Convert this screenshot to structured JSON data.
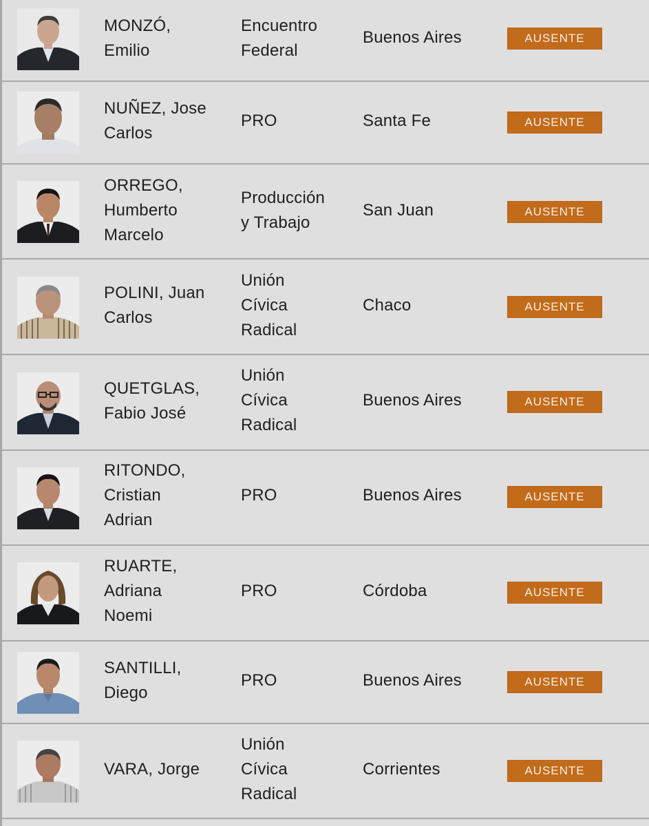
{
  "rows": [
    {
      "name_lines": [
        "MONZÓ,",
        "Emilio"
      ],
      "party_lines": [
        "Encuentro",
        "Federal"
      ],
      "district": "Buenos Aires",
      "status": "AUSENTE"
    },
    {
      "name_lines": [
        "NUÑEZ, Jose",
        "Carlos"
      ],
      "party_lines": [
        "PRO"
      ],
      "district": "Santa Fe",
      "status": "AUSENTE"
    },
    {
      "name_lines": [
        "ORREGO,",
        "Humberto",
        "Marcelo"
      ],
      "party_lines": [
        "Producción",
        "y Trabajo"
      ],
      "district": "San Juan",
      "status": "AUSENTE"
    },
    {
      "name_lines": [
        "POLINI, Juan",
        "Carlos"
      ],
      "party_lines": [
        "Unión",
        "Cívica",
        "Radical"
      ],
      "district": "Chaco",
      "status": "AUSENTE"
    },
    {
      "name_lines": [
        "QUETGLAS,",
        "Fabio José"
      ],
      "party_lines": [
        "Unión",
        "Cívica",
        "Radical"
      ],
      "district": "Buenos Aires",
      "status": "AUSENTE"
    },
    {
      "name_lines": [
        "RITONDO,",
        "Cristian",
        "Adrian"
      ],
      "party_lines": [
        "PRO"
      ],
      "district": "Buenos Aires",
      "status": "AUSENTE"
    },
    {
      "name_lines": [
        "RUARTE,",
        "Adriana",
        "Noemi"
      ],
      "party_lines": [
        "PRO"
      ],
      "district": "Córdoba",
      "status": "AUSENTE"
    },
    {
      "name_lines": [
        "SANTILLI,",
        "Diego"
      ],
      "party_lines": [
        "PRO"
      ],
      "district": "Buenos Aires",
      "status": "AUSENTE"
    },
    {
      "name_lines": [
        "VARA, Jorge"
      ],
      "party_lines": [
        "Unión",
        "Cívica",
        "Radical"
      ],
      "district": "Corrientes",
      "status": "AUSENTE"
    }
  ],
  "colors": {
    "badge": "#c26b1a",
    "badge_text": "#f6efe6",
    "background": "#dfdfdf",
    "divider": "#a9a9a9"
  },
  "icons": [
    "person-photo"
  ]
}
